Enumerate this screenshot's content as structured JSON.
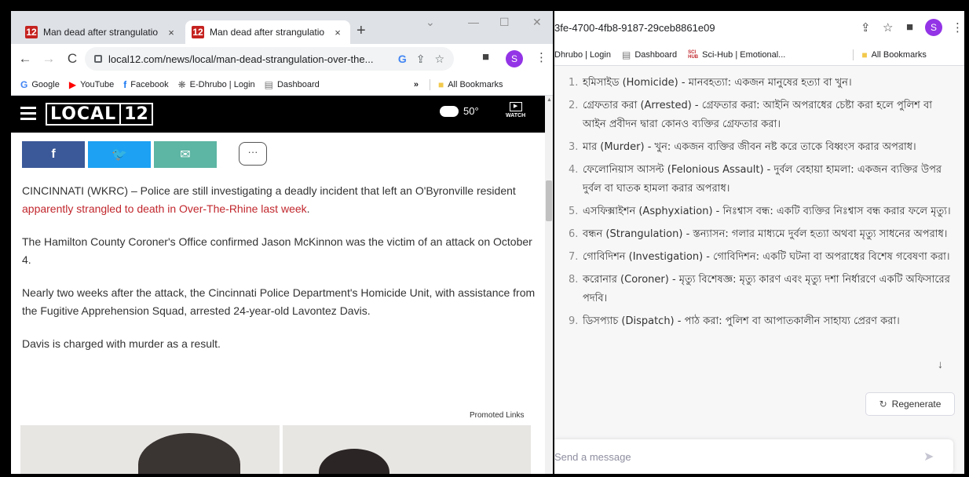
{
  "left_browser": {
    "tabs": [
      {
        "title": "Man dead after strangulatio",
        "favicon": "12",
        "close": "×"
      },
      {
        "title": "Man dead after strangulatio",
        "favicon": "12",
        "close": "×"
      }
    ],
    "new_tab": "+",
    "url": "local12.com/news/local/man-dead-strangulation-over-the...",
    "bookmarks": [
      {
        "icon": "G",
        "label": "Google",
        "color": "#4285f4"
      },
      {
        "icon": "▶",
        "label": "YouTube",
        "color": "#ff0000"
      },
      {
        "icon": "f",
        "label": "Facebook",
        "color": "#1877f2"
      },
      {
        "icon": "❋",
        "label": "E-Dhrubo | Login",
        "color": "#666666"
      },
      {
        "icon": "▤",
        "label": "Dashboard",
        "color": "#777777"
      }
    ],
    "bookmarks_more": "»",
    "all_bookmarks": "All Bookmarks",
    "avatar_letter": "S"
  },
  "site": {
    "logo_word": "LOCAL",
    "logo_number": "12",
    "temperature": "50°",
    "watch_label": "WATCH",
    "share_facebook": "f",
    "share_twitter": "🐦",
    "share_email": "✉",
    "comment": "···"
  },
  "article": {
    "p1_before": "CINCINNATI (WKRC) – Police are still investigating a deadly incident that left an O'Byronville resident ",
    "p1_link": "apparently strangled to death in Over-The-Rhine last week",
    "p1_after": ".",
    "p2": "The Hamilton County Coroner's Office confirmed Jason McKinnon was the victim of an attack on October 4.",
    "p3": "Nearly two weeks after the attack, the Cincinnati Police Department's Homicide Unit, with assistance from the Fugitive Apprehension Squad, arrested 24-year-old Lavontez Davis.",
    "p4": "Davis is charged with murder as a result.",
    "promoted": "Promoted Links"
  },
  "right_browser": {
    "url": "3fe-4700-4fb8-9187-29ceb8861e09",
    "avatar_letter": "S",
    "bookmarks": [
      {
        "label": "Dhrubo | Login"
      },
      {
        "label": "Dashboard"
      },
      {
        "label": "Sci-Hub | Emotional..."
      }
    ],
    "all_bookmarks": "All Bookmarks"
  },
  "chat": {
    "items": [
      {
        "num": "1.",
        "text": "হমিসাইড (Homicide) - মানবহত্যা: একজন মানুষের হত্যা বা খুন।"
      },
      {
        "num": "2.",
        "text": "গ্রেফতার করা (Arrested) - গ্রেফতার করা: আইনি অপরাধের চেষ্টা করা হলে পুলিশ বা আইন প্রবীদন দ্বারা কোনও ব্যক্তির গ্রেফতার করা।"
      },
      {
        "num": "3.",
        "text": "মার (Murder) - খুন: একজন ব্যক্তির জীবন নষ্ট করে তাকে বিধ্বংস করার অপরাধ।"
      },
      {
        "num": "4.",
        "text": "ফেলোনিয়াস আসল্ট (Felonious Assault) - দুর্বল বেহায়া হামলা: একজন ব্যক্তির উপর দুর্বল বা ঘাতক হামলা করার অপরাধ।"
      },
      {
        "num": "5.",
        "text": "এসফিক্সাইশন (Asphyxiation) - নিঃশ্বাস বন্ধ: একটি ব্যক্তির নিঃশ্বাস বন্ধ করার ফলে মৃত্যু।"
      },
      {
        "num": "6.",
        "text": "বন্ধন (Strangulation) - স্তন্যাসন: গলার মাধ্যমে দুর্বল হত্যা অথবা মৃত্যু সাধনের অপরাধ।"
      },
      {
        "num": "7.",
        "text": "গোবিদিশন (Investigation) - গোবিদিশন: একটি ঘটনা বা অপরাধের বিশেষ গবেষণা করা।"
      },
      {
        "num": "8.",
        "text": "করোনার (Coroner) - মৃত্যু বিশেষজ্ঞ: মৃত্যু কারণ এবং মৃত্যু দশা নির্ধারণে একটি অফিসারের পদবি।"
      },
      {
        "num": "9.",
        "text": "ডিসপ্যাচ (Dispatch) - পাঠ করা: পুলিশ বা আপাতকালীন সাহায্য প্রেরণ করা।"
      }
    ],
    "regenerate": "Regenerate",
    "message_placeholder": "Send a message"
  }
}
